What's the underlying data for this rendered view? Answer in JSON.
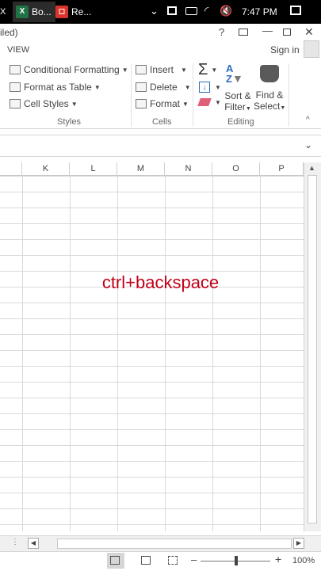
{
  "taskbar": {
    "apps": [
      {
        "label": "X",
        "icon": "excel-icon"
      },
      {
        "label": "Bo...",
        "icon": "excel-icon"
      },
      {
        "label": "Re...",
        "icon": "recorder-icon"
      }
    ],
    "time": "7:47 PM"
  },
  "titlebar": {
    "title_fragment": "iled)"
  },
  "ribbon_tabs": {
    "view": "VIEW",
    "sign_in": "Sign in"
  },
  "ribbon": {
    "styles": {
      "conditional_formatting": "Conditional Formatting",
      "format_as_table": "Format as Table",
      "cell_styles": "Cell Styles",
      "label": "Styles"
    },
    "cells": {
      "insert": "Insert",
      "delete": "Delete",
      "format": "Format",
      "label": "Cells"
    },
    "editing": {
      "sort_filter_1": "Sort &",
      "sort_filter_2": "Filter",
      "find_select_1": "Find &",
      "find_select_2": "Select",
      "label": "Editing"
    }
  },
  "grid": {
    "columns": [
      "K",
      "L",
      "M",
      "N",
      "O",
      "P"
    ]
  },
  "overlay_text": "ctrl+backspace",
  "status": {
    "zoom": "100%"
  },
  "colors": {
    "overlay": "#c00018",
    "excel_green": "#217346"
  }
}
